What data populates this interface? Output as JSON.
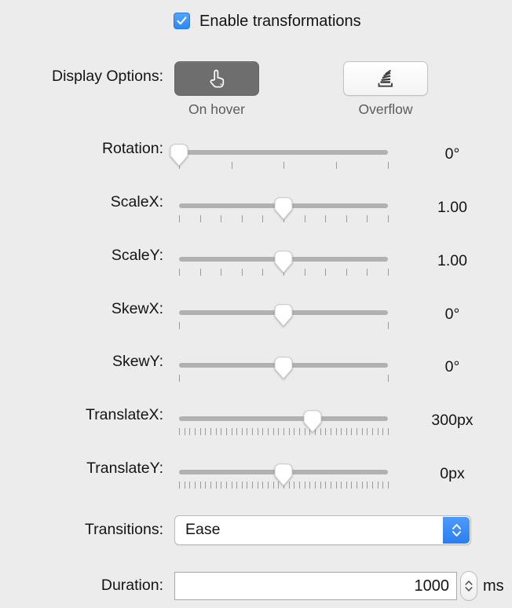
{
  "enable": {
    "label": "Enable transformations",
    "checked": true,
    "accent_color": "#3b8cf5"
  },
  "display_options": {
    "label": "Display Options:",
    "buttons": [
      {
        "caption": "On hover",
        "icon": "pointing-hand-icon",
        "selected": true
      },
      {
        "caption": "Overflow",
        "icon": "overflow-stack-icon",
        "selected": false
      }
    ]
  },
  "sliders": [
    {
      "label": "Rotation:",
      "value_text": "0°",
      "position_pct": 0,
      "tick_count": 5
    },
    {
      "label": "ScaleX:",
      "value_text": "1.00",
      "position_pct": 50,
      "tick_count": 11
    },
    {
      "label": "ScaleY:",
      "value_text": "1.00",
      "position_pct": 50,
      "tick_count": 11
    },
    {
      "label": "SkewX:",
      "value_text": "0°",
      "position_pct": 50,
      "tick_count": 2
    },
    {
      "label": "SkewY:",
      "value_text": "0°",
      "position_pct": 50,
      "tick_count": 2
    },
    {
      "label": "TranslateX:",
      "value_text": "300px",
      "position_pct": 64,
      "tick_count": 41
    },
    {
      "label": "TranslateY:",
      "value_text": "0px",
      "position_pct": 50,
      "tick_count": 41
    }
  ],
  "transitions": {
    "label": "Transitions:",
    "selected": "Ease",
    "options": [
      "Ease"
    ],
    "stepper_color": "#3b8cf5"
  },
  "duration": {
    "label": "Duration:",
    "value": "1000",
    "unit": "ms"
  }
}
